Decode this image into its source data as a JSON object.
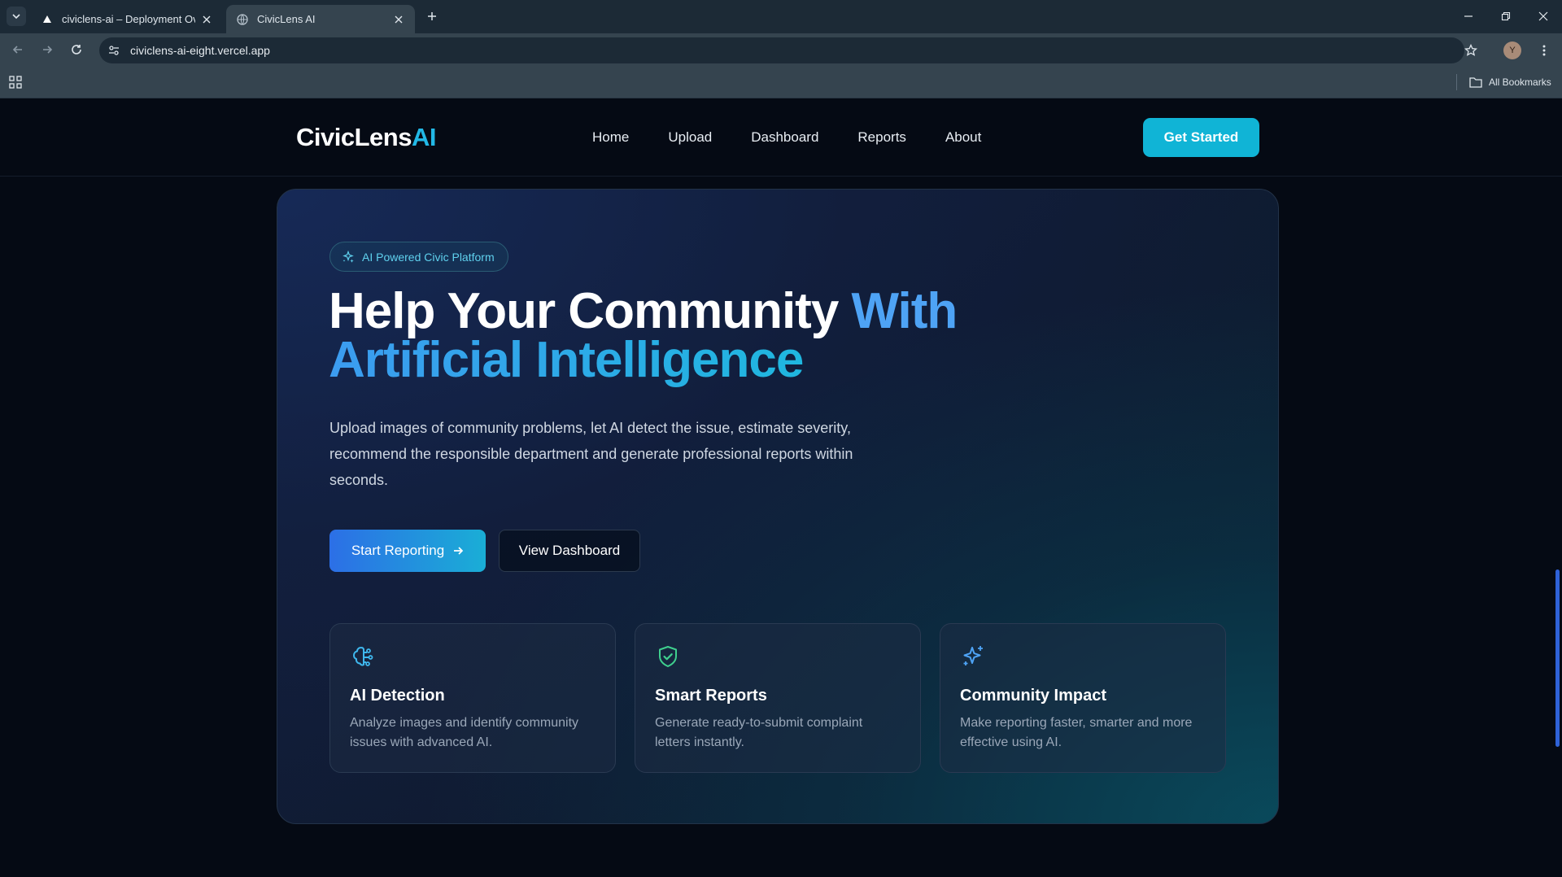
{
  "browser": {
    "tabs": [
      {
        "title": "civiclens-ai – Deployment Over",
        "active": false
      },
      {
        "title": "CivicLens AI",
        "active": true
      }
    ],
    "url": "civiclens-ai-eight.vercel.app",
    "profile_initial": "Y",
    "all_bookmarks": "All Bookmarks"
  },
  "nav": {
    "logo_main": "CivicLens",
    "logo_accent": "AI",
    "links": [
      "Home",
      "Upload",
      "Dashboard",
      "Reports",
      "About"
    ],
    "cta": "Get Started"
  },
  "hero": {
    "badge": "AI Powered Civic Platform",
    "headline_part1": "Help Your Community ",
    "headline_part2": "With",
    "headline_line2": "Artificial Intelligence",
    "description": "Upload images of community problems, let AI detect the issue, estimate severity, recommend the responsible department and generate professional reports within seconds.",
    "primary_button": "Start Reporting",
    "secondary_button": "View Dashboard"
  },
  "features": [
    {
      "icon": "brain-icon",
      "title": "AI Detection",
      "text": "Analyze images and identify community issues with advanced AI."
    },
    {
      "icon": "shield-check-icon",
      "title": "Smart Reports",
      "text": "Generate ready-to-submit complaint letters instantly."
    },
    {
      "icon": "sparkles-icon",
      "title": "Community Impact",
      "text": "Make reporting faster, smarter and more effective using AI."
    }
  ],
  "colors": {
    "accent_cyan": "#10b4d6",
    "accent_blue": "#2c6fe6",
    "background": "#050a14",
    "shield_green": "#3fcf8e"
  }
}
